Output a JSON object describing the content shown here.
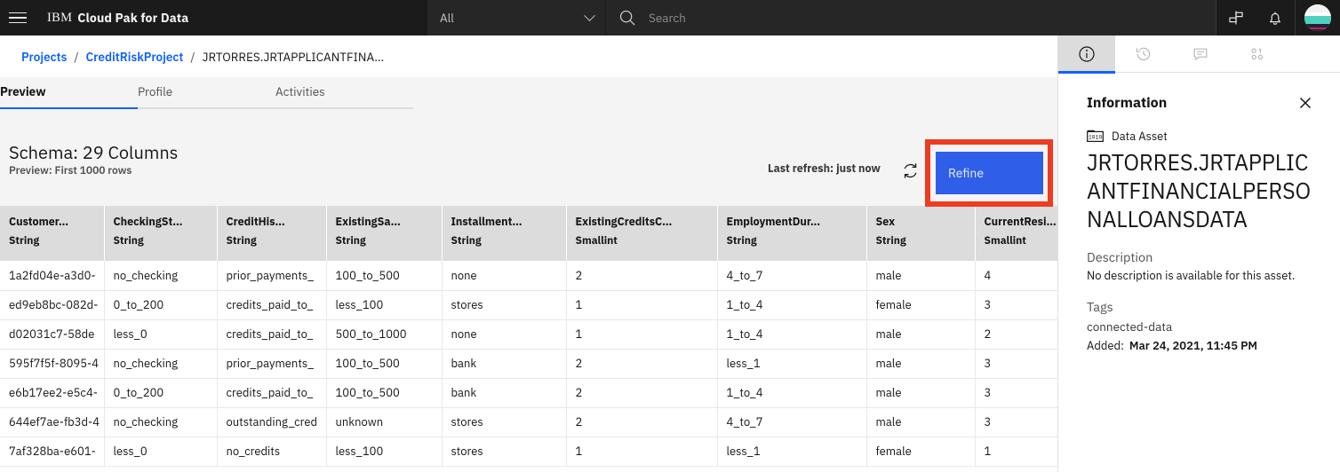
{
  "topbar": {
    "menu_icon": "hamburger-icon",
    "brand_prefix": "IBM",
    "brand_name": "Cloud Pak for Data",
    "scope_value": "All",
    "search_placeholder": "Search",
    "search_value": "",
    "switcher_icon": "signpost-icon",
    "notifications_icon": "bell-icon",
    "avatar_label": "user-avatar"
  },
  "breadcrumb": {
    "item1": "Projects",
    "sep1": "/",
    "item2": "CreditRiskProject",
    "sep2": "/",
    "current": "JRTORRES.JRTAPPLICANTFINA…"
  },
  "main_tabs": [
    {
      "label": "Preview"
    },
    {
      "label": "Profile"
    },
    {
      "label": "Activities"
    }
  ],
  "schema": {
    "title": "Schema:  29 Columns",
    "subtitle": "Preview: First 1000 rows",
    "refresh_text": "Last refresh: just now",
    "refresh_icon": "refresh-icon",
    "refine_label": "Refine",
    "highlight_color": "#ee3b22",
    "refine_color": "#2f5fe8"
  },
  "table": {
    "columns": [
      {
        "name": "Customer…",
        "type": "String"
      },
      {
        "name": "CheckingSt…",
        "type": "String"
      },
      {
        "name": "CreditHis…",
        "type": "String"
      },
      {
        "name": "ExistingSa…",
        "type": "String"
      },
      {
        "name": "Installment…",
        "type": "String"
      },
      {
        "name": "ExistingCreditsC…",
        "type": "Smallint"
      },
      {
        "name": "EmploymentDur…",
        "type": "String"
      },
      {
        "name": "Sex",
        "type": "String"
      },
      {
        "name": "CurrentResi…",
        "type": "Smallint"
      }
    ],
    "rows": [
      [
        "1a2fd04e-a3d0-",
        "no_checking",
        "prior_payments_",
        "100_to_500",
        "none",
        "2",
        "4_to_7",
        "male",
        "4"
      ],
      [
        "ed9eb8bc-082d-",
        "0_to_200",
        "credits_paid_to_",
        "less_100",
        "stores",
        "1",
        "1_to_4",
        "female",
        "3"
      ],
      [
        "d02031c7-58de",
        "less_0",
        "credits_paid_to_",
        "500_to_1000",
        "none",
        "1",
        "1_to_4",
        "male",
        "2"
      ],
      [
        "595f7f5f-8095-4",
        "no_checking",
        "prior_payments_",
        "100_to_500",
        "bank",
        "2",
        "less_1",
        "male",
        "3"
      ],
      [
        "e6b17ee2-e5c4-",
        "0_to_200",
        "credits_paid_to_",
        "100_to_500",
        "bank",
        "2",
        "1_to_4",
        "male",
        "3"
      ],
      [
        "644ef7ae-fb3d-4",
        "no_checking",
        "outstanding_cred",
        "unknown",
        "stores",
        "2",
        "4_to_7",
        "male",
        "3"
      ],
      [
        "7af328ba-e601-",
        "less_0",
        "no_credits",
        "less_100",
        "stores",
        "1",
        "less_1",
        "female",
        "1"
      ]
    ]
  },
  "right_panel": {
    "tabs": [
      {
        "icon": "information-icon"
      },
      {
        "icon": "history-clock-icon"
      },
      {
        "icon": "comment-icon"
      },
      {
        "icon": "data-quality-icon"
      }
    ],
    "title": "Information",
    "close_icon": "close-icon",
    "asset_type_icon": "data-asset-icon",
    "asset_type": "Data Asset",
    "asset_name": "JRTORRES.JRTAPPLICANTFINANCIALPERSONALLOANSDATA",
    "description_label": "Description",
    "description_value": "No description is available for this asset.",
    "tags_label": "Tags",
    "tag_value": "connected-data",
    "added_label": "Added:",
    "added_value": "Mar 24, 2021, 11:45 PM"
  }
}
